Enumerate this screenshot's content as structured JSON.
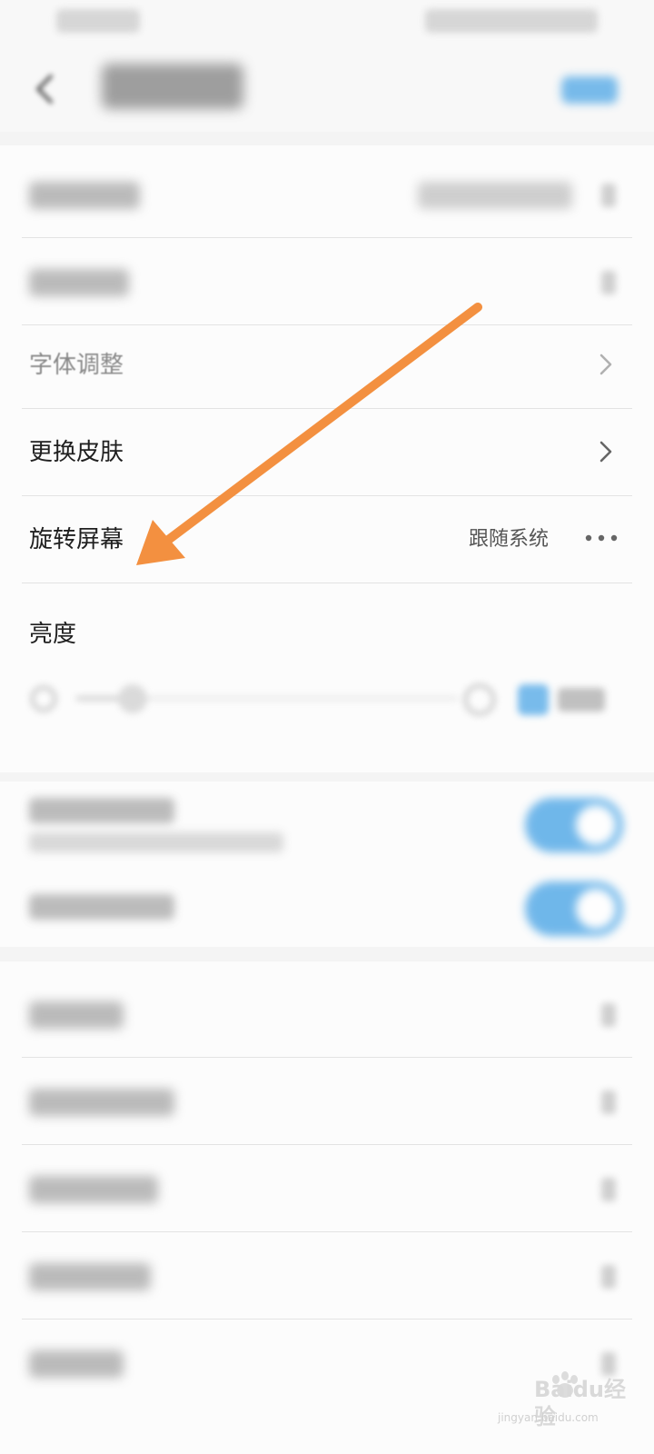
{
  "settings": {
    "font_size_label": "字体调整",
    "skin_label": "更换皮肤",
    "rotate_label": "旋转屏幕",
    "rotate_value": "跟随系统",
    "brightness_label": "亮度"
  },
  "colors": {
    "accent": "#4da6e6",
    "arrow": "#f39040"
  },
  "icons": {
    "back": "back-arrow-icon",
    "chevron": "chevron-right-icon",
    "more": "more-dots-icon",
    "toggle": "toggle-switch-on"
  },
  "watermark": {
    "brand": "Baidu经验",
    "url": "jingyan.baidu.com"
  }
}
